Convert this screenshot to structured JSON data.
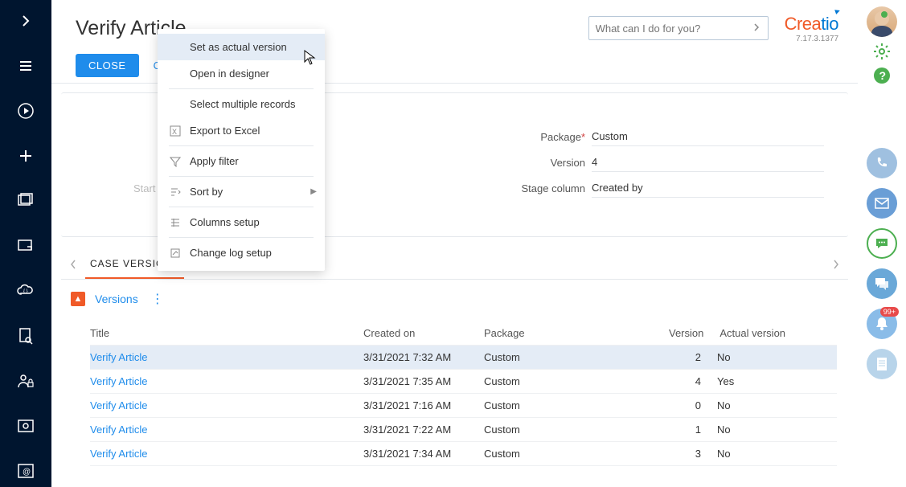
{
  "header": {
    "title": "Verify Article",
    "search_placeholder": "What can I do for you?",
    "logo_part1": "Crea",
    "logo_part2": "tio",
    "version_string": "7.17.3.1377"
  },
  "actions": {
    "close_label": "CLOSE",
    "open_label": "OPEN"
  },
  "details": {
    "start_placeholder": "Start con",
    "package_label": "Package",
    "package_value": "Custom",
    "version_label": "Version",
    "version_value": "4",
    "stage_label": "Stage column",
    "stage_value": "Created by"
  },
  "tabs": {
    "active": "CASE VERSIONS"
  },
  "versions": {
    "section_title": "Versions",
    "columns": {
      "title": "Title",
      "created": "Created on",
      "package": "Package",
      "version": "Version",
      "actual": "Actual version"
    },
    "rows": [
      {
        "title": "Verify Article",
        "created": "3/31/2021 7:32 AM",
        "package": "Custom",
        "version": "2",
        "actual": "No",
        "selected": true
      },
      {
        "title": "Verify Article",
        "created": "3/31/2021 7:35 AM",
        "package": "Custom",
        "version": "4",
        "actual": "Yes"
      },
      {
        "title": "Verify Article",
        "created": "3/31/2021 7:16 AM",
        "package": "Custom",
        "version": "0",
        "actual": "No"
      },
      {
        "title": "Verify Article",
        "created": "3/31/2021 7:22 AM",
        "package": "Custom",
        "version": "1",
        "actual": "No"
      },
      {
        "title": "Verify Article",
        "created": "3/31/2021 7:34 AM",
        "package": "Custom",
        "version": "3",
        "actual": "No"
      }
    ]
  },
  "context_menu": {
    "items": [
      {
        "label": "Set as actual version",
        "icon": "",
        "hover": true
      },
      {
        "label": "Open in designer",
        "icon": ""
      },
      {
        "sep": true
      },
      {
        "label": "Select multiple records",
        "icon": ""
      },
      {
        "label": "Export to Excel",
        "icon": "excel"
      },
      {
        "sep": true
      },
      {
        "label": "Apply filter",
        "icon": "filter"
      },
      {
        "sep": true
      },
      {
        "label": "Sort by",
        "icon": "sort",
        "sub": true
      },
      {
        "sep": true
      },
      {
        "label": "Columns setup",
        "icon": "columns"
      },
      {
        "sep": true
      },
      {
        "label": "Change log setup",
        "icon": "log"
      }
    ]
  },
  "right_rail": {
    "notification_badge": "99+"
  }
}
